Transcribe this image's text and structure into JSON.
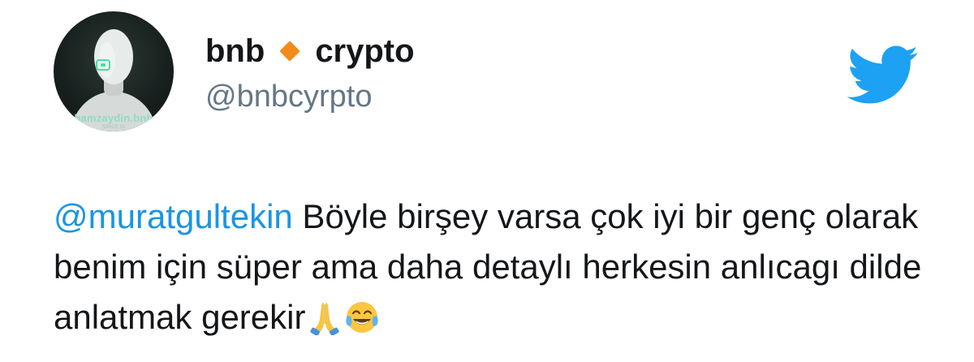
{
  "user": {
    "display_name_part1": "bnb",
    "display_name_part2": "crypto",
    "handle": "@bnbcyrpto",
    "avatar_caption": "hamzaydin.bnb",
    "avatar_subcaption": "SPACE ID"
  },
  "tweet": {
    "mention": "@muratgultekin",
    "text": " Böyle birşey varsa çok iyi bir genç olarak benim için süper ama daha detaylı herkesin anlıcagı dilde anlatmak gerekir",
    "emojis": [
      "folded-hands",
      "face-with-tears-of-joy"
    ]
  },
  "colors": {
    "twitter_blue": "#1da1f2",
    "mention_blue": "#1b95e0",
    "diamond_orange": "#f28b1b",
    "handle_gray": "#657786"
  },
  "icons": {
    "brand": "twitter-bird-icon",
    "separator": "diamond-icon"
  }
}
